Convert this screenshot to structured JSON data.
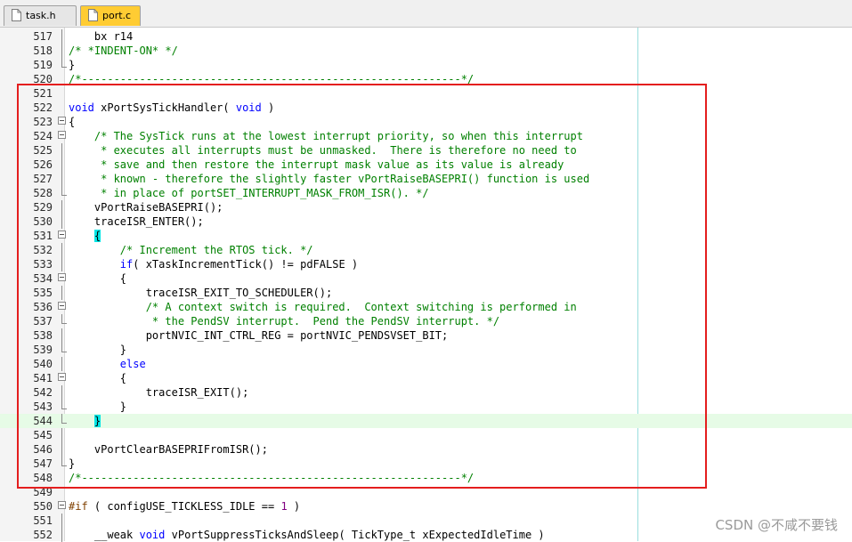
{
  "tabs": [
    {
      "label": "task.h",
      "active": false
    },
    {
      "label": "port.c",
      "active": true
    }
  ],
  "colors": {
    "keyword": "#0000ff",
    "comment": "#008000",
    "number": "#800080",
    "preprocessor": "#804000",
    "plain": "#000000",
    "highlight_line": "#e6fbe6",
    "brace_match": "#00e5e5",
    "annotation_box": "#e41e1e"
  },
  "editor": {
    "lines": [
      {
        "num": "517",
        "fold": "bar",
        "segs": [
          {
            "t": "    bx r14",
            "c": "plain"
          }
        ]
      },
      {
        "num": "518",
        "fold": "bar",
        "segs": [
          {
            "t": "/* *INDENT-ON* */",
            "c": "cmt"
          }
        ]
      },
      {
        "num": "519",
        "fold": "end",
        "segs": [
          {
            "t": "}",
            "c": "plain"
          }
        ]
      },
      {
        "num": "520",
        "fold": "",
        "segs": [
          {
            "t": "/*-----------------------------------------------------------*/",
            "c": "cmt"
          }
        ]
      },
      {
        "num": "521",
        "fold": "",
        "segs": []
      },
      {
        "num": "522",
        "fold": "",
        "segs": [
          {
            "t": "void",
            "c": "kw"
          },
          {
            "t": " xPortSysTickHandler( ",
            "c": "plain"
          },
          {
            "t": "void",
            "c": "kw"
          },
          {
            "t": " )",
            "c": "plain"
          }
        ]
      },
      {
        "num": "523",
        "fold": "open",
        "segs": [
          {
            "t": "{",
            "c": "plain"
          }
        ]
      },
      {
        "num": "524",
        "fold": "open",
        "segs": [
          {
            "t": "    /* The SysTick runs at the lowest interrupt priority, so when this interrupt",
            "c": "cmt"
          }
        ]
      },
      {
        "num": "525",
        "fold": "bar",
        "segs": [
          {
            "t": "     * executes all interrupts must be unmasked.  There is therefore no need to",
            "c": "cmt"
          }
        ]
      },
      {
        "num": "526",
        "fold": "bar",
        "segs": [
          {
            "t": "     * save and then restore the interrupt mask value as its value is already",
            "c": "cmt"
          }
        ]
      },
      {
        "num": "527",
        "fold": "bar",
        "segs": [
          {
            "t": "     * known - therefore the slightly faster vPortRaiseBASEPRI() function is used",
            "c": "cmt"
          }
        ]
      },
      {
        "num": "528",
        "fold": "end",
        "segs": [
          {
            "t": "     * in place of portSET_INTERRUPT_MASK_FROM_ISR(). */",
            "c": "cmt"
          }
        ]
      },
      {
        "num": "529",
        "fold": "bar",
        "segs": [
          {
            "t": "    vPortRaiseBASEPRI();",
            "c": "plain"
          }
        ]
      },
      {
        "num": "530",
        "fold": "bar",
        "segs": [
          {
            "t": "    traceISR_ENTER();",
            "c": "plain"
          }
        ]
      },
      {
        "num": "531",
        "fold": "open",
        "segs": [
          {
            "t": "    ",
            "c": "plain"
          },
          {
            "t": "{",
            "c": "brace"
          }
        ]
      },
      {
        "num": "532",
        "fold": "bar",
        "segs": [
          {
            "t": "        /* Increment the RTOS tick. */",
            "c": "cmt"
          }
        ]
      },
      {
        "num": "533",
        "fold": "bar",
        "segs": [
          {
            "t": "        ",
            "c": "plain"
          },
          {
            "t": "if",
            "c": "kw"
          },
          {
            "t": "( xTaskIncrementTick() != pdFALSE )",
            "c": "plain"
          }
        ]
      },
      {
        "num": "534",
        "fold": "open",
        "segs": [
          {
            "t": "        {",
            "c": "plain"
          }
        ]
      },
      {
        "num": "535",
        "fold": "bar",
        "segs": [
          {
            "t": "            traceISR_EXIT_TO_SCHEDULER();",
            "c": "plain"
          }
        ]
      },
      {
        "num": "536",
        "fold": "open",
        "segs": [
          {
            "t": "            /* A context switch is required.  Context switching is performed in",
            "c": "cmt"
          }
        ]
      },
      {
        "num": "537",
        "fold": "end",
        "segs": [
          {
            "t": "             * the PendSV interrupt.  Pend the PendSV interrupt. */",
            "c": "cmt"
          }
        ]
      },
      {
        "num": "538",
        "fold": "bar",
        "segs": [
          {
            "t": "            portNVIC_INT_CTRL_REG = portNVIC_PENDSVSET_BIT;",
            "c": "plain"
          }
        ]
      },
      {
        "num": "539",
        "fold": "end",
        "segs": [
          {
            "t": "        }",
            "c": "plain"
          }
        ]
      },
      {
        "num": "540",
        "fold": "bar",
        "segs": [
          {
            "t": "        ",
            "c": "plain"
          },
          {
            "t": "else",
            "c": "kw"
          }
        ]
      },
      {
        "num": "541",
        "fold": "open",
        "segs": [
          {
            "t": "        {",
            "c": "plain"
          }
        ]
      },
      {
        "num": "542",
        "fold": "bar",
        "segs": [
          {
            "t": "            traceISR_EXIT();",
            "c": "plain"
          }
        ]
      },
      {
        "num": "543",
        "fold": "end",
        "segs": [
          {
            "t": "        }",
            "c": "plain"
          }
        ]
      },
      {
        "num": "544",
        "fold": "end",
        "hl": true,
        "segs": [
          {
            "t": "    ",
            "c": "plain"
          },
          {
            "t": "}",
            "c": "brace"
          }
        ]
      },
      {
        "num": "545",
        "fold": "bar",
        "segs": []
      },
      {
        "num": "546",
        "fold": "bar",
        "segs": [
          {
            "t": "    vPortClearBASEPRIFromISR();",
            "c": "plain"
          }
        ]
      },
      {
        "num": "547",
        "fold": "end",
        "segs": [
          {
            "t": "}",
            "c": "plain"
          }
        ]
      },
      {
        "num": "548",
        "fold": "",
        "segs": [
          {
            "t": "/*-----------------------------------------------------------*/",
            "c": "cmt"
          }
        ]
      },
      {
        "num": "549",
        "fold": "",
        "segs": []
      },
      {
        "num": "550",
        "fold": "open",
        "segs": [
          {
            "t": "#if",
            "c": "pp"
          },
          {
            "t": " ( configUSE_TICKLESS_IDLE == ",
            "c": "plain"
          },
          {
            "t": "1",
            "c": "num"
          },
          {
            "t": " )",
            "c": "plain"
          }
        ]
      },
      {
        "num": "551",
        "fold": "bar",
        "segs": []
      },
      {
        "num": "552",
        "fold": "bar",
        "segs": [
          {
            "t": "    __weak ",
            "c": "plain"
          },
          {
            "t": "void",
            "c": "kw"
          },
          {
            "t": " vPortSuppressTicksAndSleep( TickType_t xExpectedIdleTime )",
            "c": "plain"
          }
        ]
      }
    ]
  },
  "watermark": "CSDN @不咸不要钱"
}
